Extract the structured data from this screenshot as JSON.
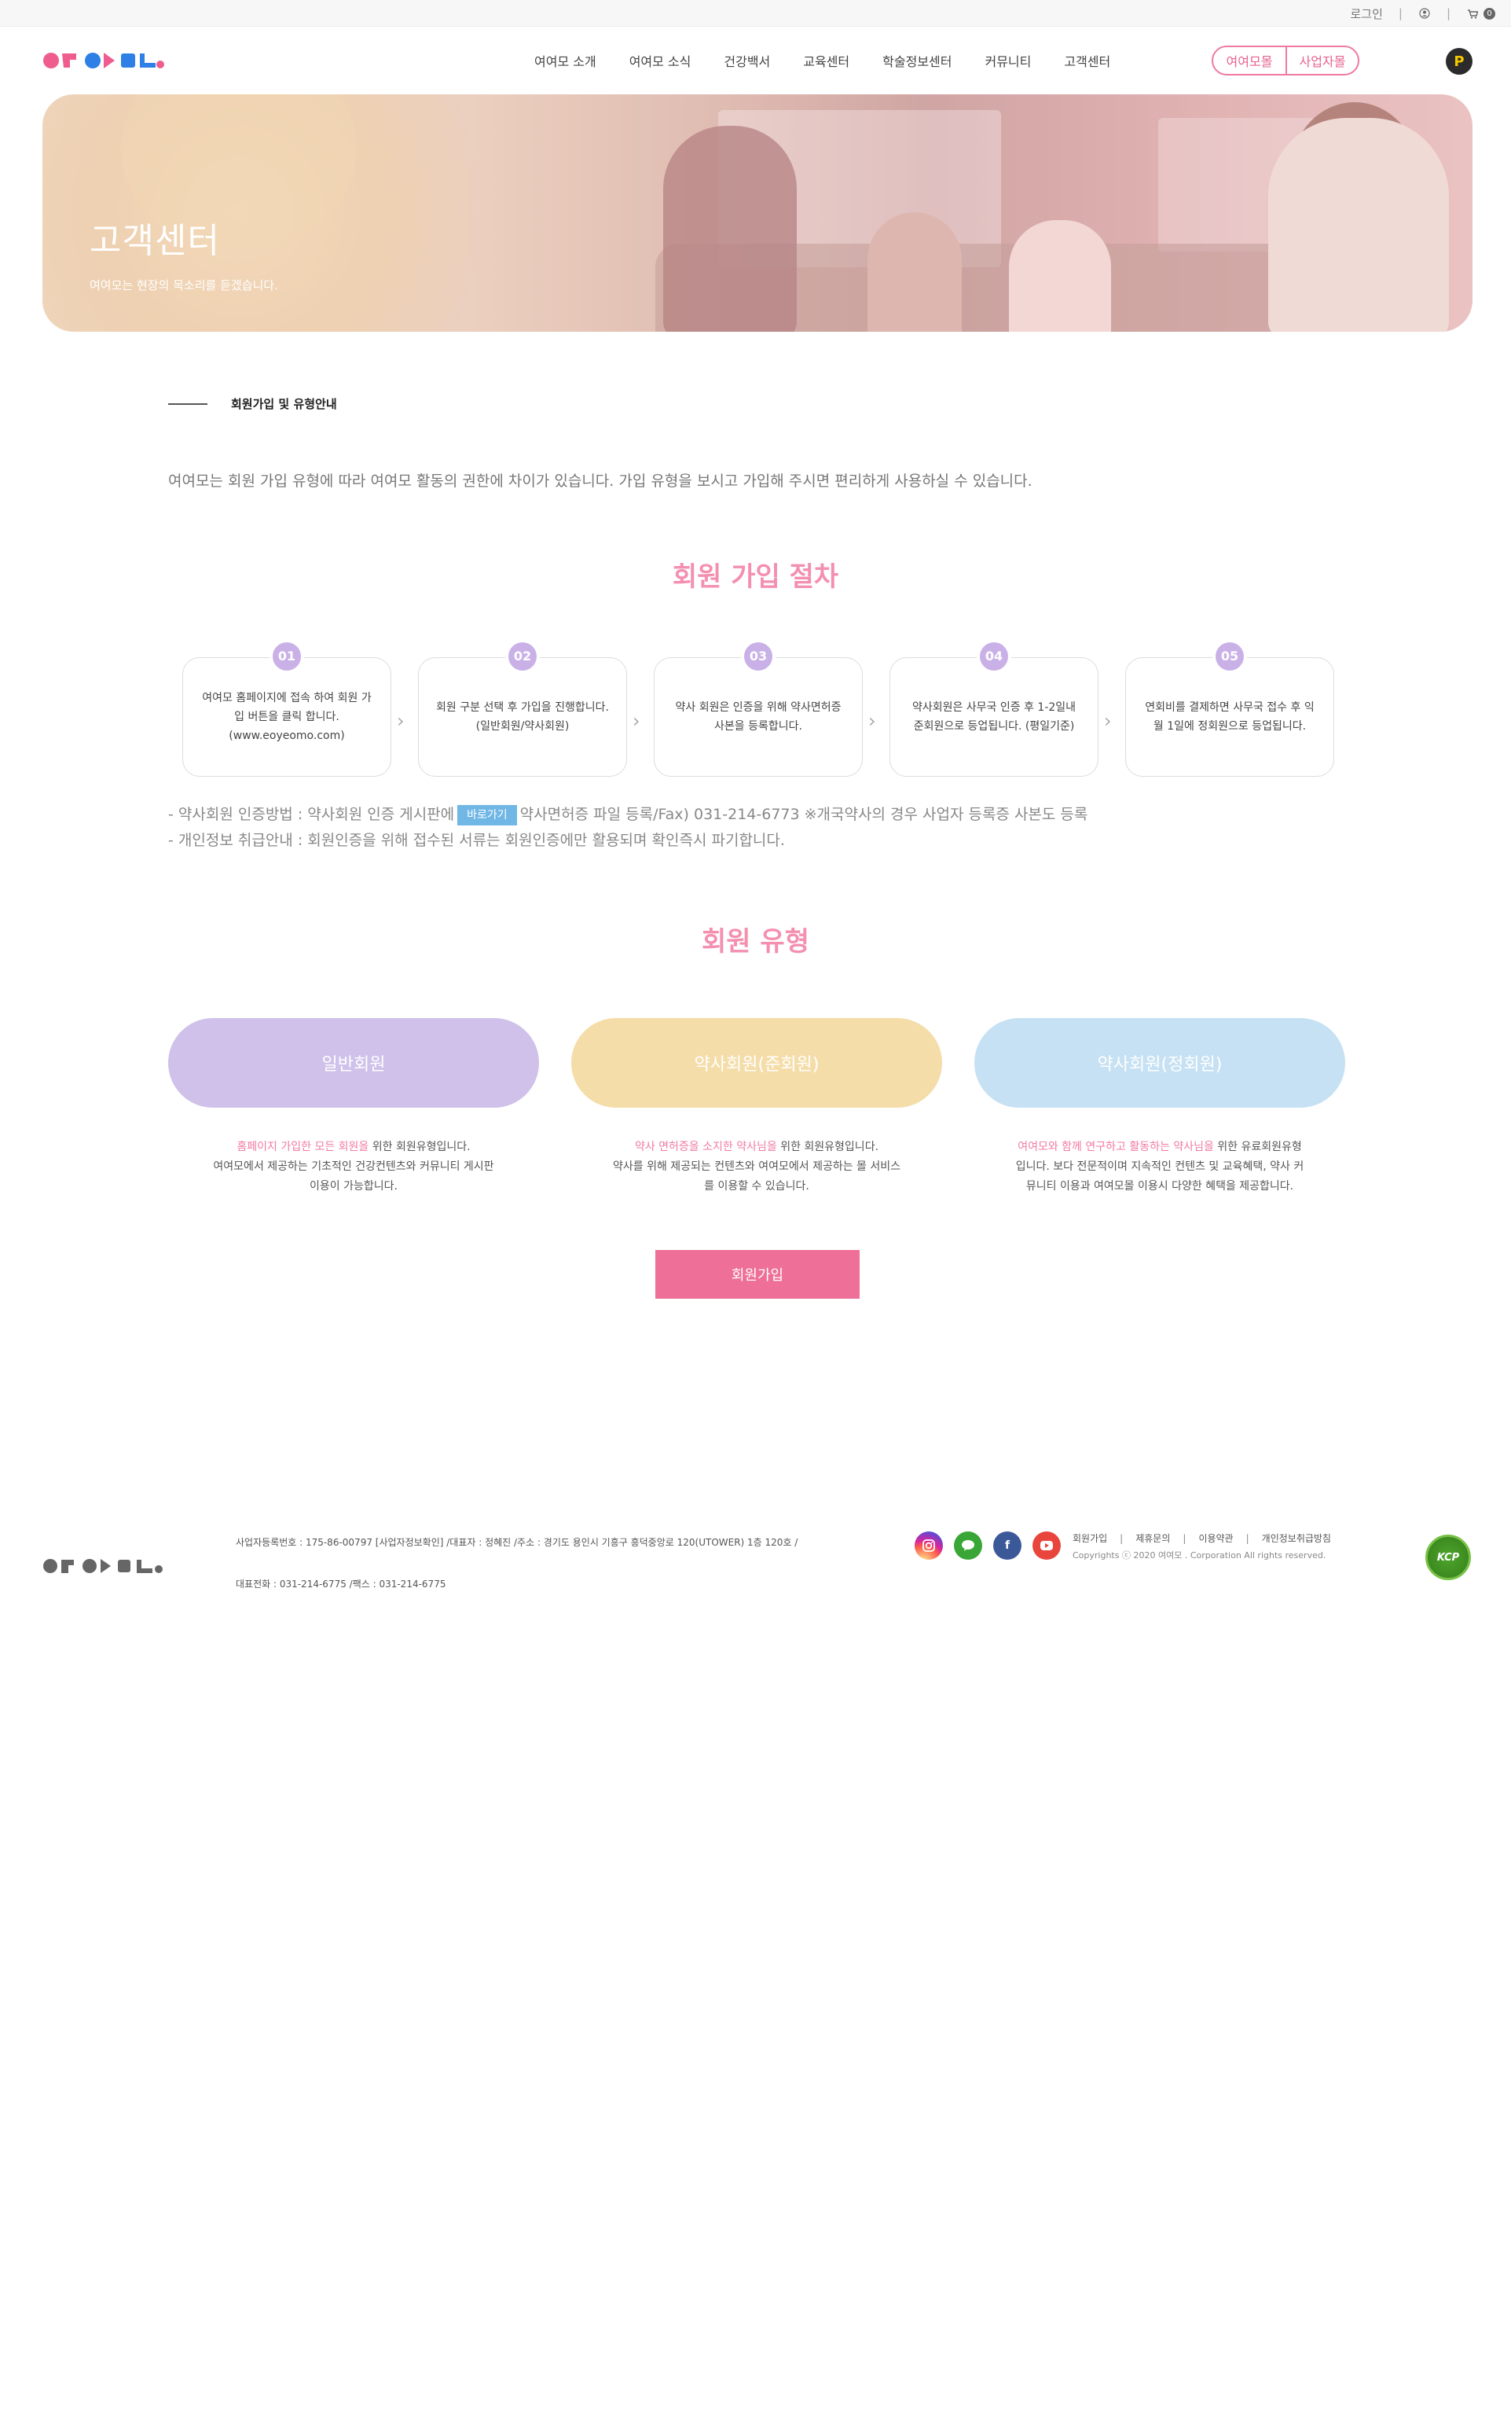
{
  "topbar": {
    "login": "로그인",
    "sep": "|",
    "cart_count": "0"
  },
  "header": {
    "nav": [
      "여여모 소개",
      "여여모 소식",
      "건강백서",
      "교육센터",
      "학술정보센터",
      "커뮤니티",
      "고객센터"
    ],
    "pill_left": "여여모몰",
    "pill_right": "사업자몰",
    "point_label": "P"
  },
  "hero": {
    "title": "고객센터",
    "subtitle": "여여모는 현장의 목소리를 듣겠습니다."
  },
  "section": {
    "label": "회원가입 및 유형안내",
    "intro": "여여모는 회원 가입 유형에 따라 여여모 활동의 권한에 차이가 있습니다. 가입 유형을 보시고 가입해 주시면 편리하게 사용하실 수 있습니다."
  },
  "process": {
    "title": "회원 가입 절차",
    "steps": [
      {
        "num": "01",
        "text": "여여모 홈페이지에 접속 하여 회원 가입 버튼을 클릭 합니다. (www.eoyeomo.com)"
      },
      {
        "num": "02",
        "text": "회원 구분 선택 후 가입을 진행합니다. (일반회원/약사회원)"
      },
      {
        "num": "03",
        "text": "약사 회원은 인증을 위해 약사면허증 사본을 등록합니다."
      },
      {
        "num": "04",
        "text": "약사회원은 사무국 인증 후 1-2일내 준회원으로 등업됩니다. (평일기준)"
      },
      {
        "num": "05",
        "text": "연회비를 결제하면 사무국 접수 후 익월 1일에 정회원으로 등업됩니다."
      }
    ],
    "note1_prefix": "- 약사회원 인증방법 : 약사회원 인증 게시판에",
    "note1_button": "바로가기",
    "note1_suffix": "약사면허증 파일 등록/Fax) 031-214-6773 ※개국약사의 경우 사업자 등록증 사본도 등록",
    "note2": "- 개인정보 취급안내 : 회원인증을 위해 접수된 서류는 회원인증에만 활용되며 확인즉시 파기합니다."
  },
  "types": {
    "title": "회원 유형",
    "items": [
      {
        "label": "일반회원",
        "color": "#cfc1ea",
        "hl": "홈페이지 가입한 모든 회원을",
        "desc1": " 위한 회원유형입니다.",
        "desc2": "여여모에서 제공하는 기초적인 건강컨텐츠와 커뮤니티 게시판",
        "desc3": "이용이 가능합니다."
      },
      {
        "label": "약사회원(준회원)",
        "color": "#f5dda9",
        "hl": "약사 면허증을 소지한 약사님을",
        "desc1": " 위한 회원유형입니다.",
        "desc2": "약사를 위해 제공되는 컨텐츠와 여여모에서 제공하는 몰 서비스",
        "desc3": "를 이용할 수 있습니다."
      },
      {
        "label": "약사회원(정회원)",
        "color": "#c6e1f3",
        "hl": "여여모와 함께 연구하고 활동하는 약사님을",
        "desc1": " 위한 유료회원유형",
        "desc2": "입니다. 보다 전문적이며 지속적인 컨텐츠 및 교육혜택, 약사 커",
        "desc3": "뮤니티 이용과 여여모몰 이용시 다양한 혜택을 제공합니다."
      }
    ],
    "join_button": "회원가입"
  },
  "footer": {
    "info1": "사업자등록번호 : 175-86-00797 [사업자정보확인] /대표자 : 정혜진 /주소 : 경기도 용인시 기흥구 흥덕중앙로 120(UTOWER) 1층 120호 /",
    "info2": "대표전화 : 031-214-6775 /팩스 : 031-214-6775",
    "links": [
      "회원가입",
      "제휴문의",
      "이용약관",
      "개인정보취급방침"
    ],
    "copyright": "Copyrights ⓒ 2020 여여모 . Corporation All rights reserved.",
    "kcp": "KCP",
    "social_colors": {
      "instagram": "#c13584",
      "talk": "#3aa637",
      "facebook": "#3b5998",
      "youtube": "#e8453c"
    }
  }
}
